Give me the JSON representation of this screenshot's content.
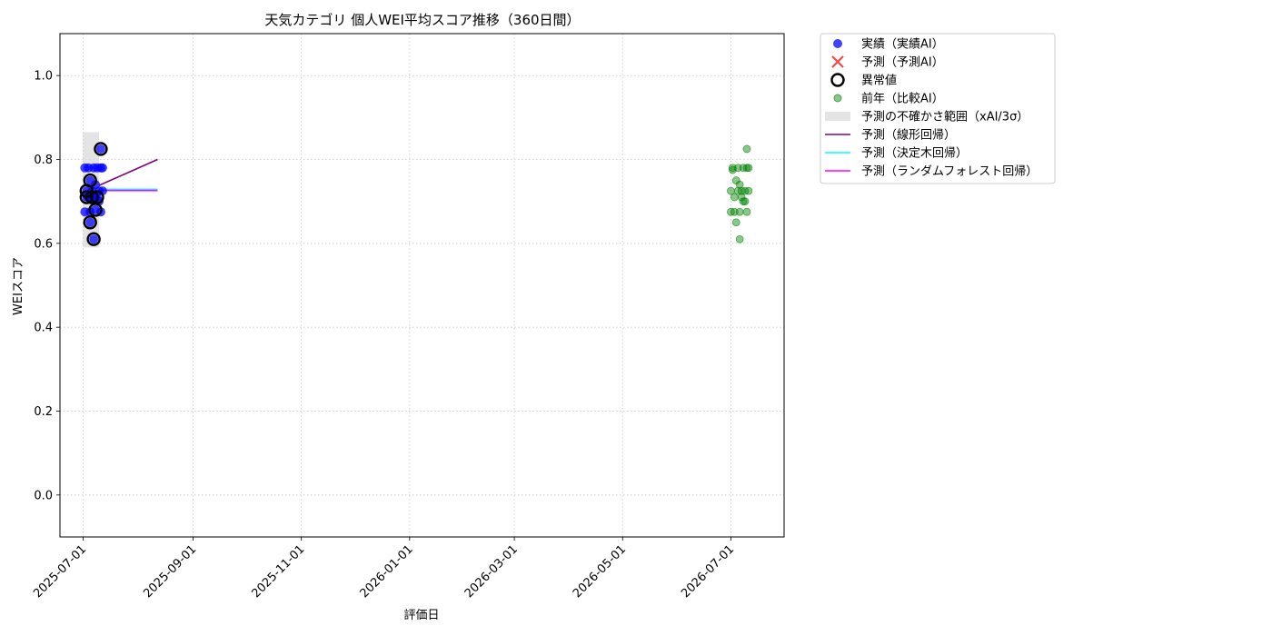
{
  "chart_data": {
    "type": "scatter",
    "title": "天気カテゴリ 個人WEI平均スコア推移（360日間）",
    "xlabel": "評価日",
    "ylabel": "WEIスコア",
    "ylim": [
      -0.1,
      1.1
    ],
    "xlim": [
      "2025-06-18",
      "2026-07-31"
    ],
    "x_ticks": [
      "2025-07-01",
      "2025-09-01",
      "2025-11-01",
      "2026-01-01",
      "2026-03-01",
      "2026-05-01",
      "2026-07-01"
    ],
    "y_ticks": [
      0.0,
      0.2,
      0.4,
      0.6,
      0.8,
      1.0
    ],
    "grid": true,
    "legend_position": "outside-top-right",
    "series": [
      {
        "name": "実績（実績AI）",
        "kind": "scatter",
        "color": "#0000ff",
        "points": [
          {
            "x": "2025-07-02",
            "y": 0.78
          },
          {
            "x": "2025-07-02",
            "y": 0.675
          },
          {
            "x": "2025-07-03",
            "y": 0.71
          },
          {
            "x": "2025-07-03",
            "y": 0.725
          },
          {
            "x": "2025-07-04",
            "y": 0.78
          },
          {
            "x": "2025-07-04",
            "y": 0.71
          },
          {
            "x": "2025-07-05",
            "y": 0.65
          },
          {
            "x": "2025-07-05",
            "y": 0.675
          },
          {
            "x": "2025-07-05",
            "y": 0.75
          },
          {
            "x": "2025-07-06",
            "y": 0.725
          },
          {
            "x": "2025-07-06",
            "y": 0.71
          },
          {
            "x": "2025-07-07",
            "y": 0.78
          },
          {
            "x": "2025-07-07",
            "y": 0.61
          },
          {
            "x": "2025-07-08",
            "y": 0.71
          },
          {
            "x": "2025-07-08",
            "y": 0.68
          },
          {
            "x": "2025-07-08",
            "y": 0.74
          },
          {
            "x": "2025-07-09",
            "y": 0.78
          },
          {
            "x": "2025-07-09",
            "y": 0.71
          },
          {
            "x": "2025-07-10",
            "y": 0.7
          },
          {
            "x": "2025-07-10",
            "y": 0.725
          },
          {
            "x": "2025-07-11",
            "y": 0.78
          },
          {
            "x": "2025-07-11",
            "y": 0.675
          },
          {
            "x": "2025-07-11",
            "y": 0.825
          },
          {
            "x": "2025-07-12",
            "y": 0.78
          },
          {
            "x": "2025-07-12",
            "y": 0.725
          }
        ]
      },
      {
        "name": "予測（予測AI）",
        "kind": "scatter",
        "color": "#ff0000",
        "points": []
      },
      {
        "name": "異常値",
        "kind": "scatter",
        "color": "#000000",
        "points": [
          {
            "x": "2025-07-03",
            "y": 0.71
          },
          {
            "x": "2025-07-03",
            "y": 0.725
          },
          {
            "x": "2025-07-05",
            "y": 0.75
          },
          {
            "x": "2025-07-05",
            "y": 0.65
          },
          {
            "x": "2025-07-06",
            "y": 0.71
          },
          {
            "x": "2025-07-07",
            "y": 0.61
          },
          {
            "x": "2025-07-08",
            "y": 0.68
          },
          {
            "x": "2025-07-09",
            "y": 0.71
          },
          {
            "x": "2025-07-11",
            "y": 0.825
          }
        ]
      },
      {
        "name": "前年（比較AI）",
        "kind": "scatter",
        "color": "#008000",
        "points": [
          {
            "x": "2026-07-01",
            "y": 0.675
          },
          {
            "x": "2026-07-01",
            "y": 0.725
          },
          {
            "x": "2026-07-02",
            "y": 0.78
          },
          {
            "x": "2026-07-02",
            "y": 0.775
          },
          {
            "x": "2026-07-03",
            "y": 0.71
          },
          {
            "x": "2026-07-03",
            "y": 0.675
          },
          {
            "x": "2026-07-04",
            "y": 0.65
          },
          {
            "x": "2026-07-04",
            "y": 0.75
          },
          {
            "x": "2026-07-05",
            "y": 0.725
          },
          {
            "x": "2026-07-05",
            "y": 0.78
          },
          {
            "x": "2026-07-06",
            "y": 0.61
          },
          {
            "x": "2026-07-06",
            "y": 0.74
          },
          {
            "x": "2026-07-06",
            "y": 0.675
          },
          {
            "x": "2026-07-07",
            "y": 0.71
          },
          {
            "x": "2026-07-07",
            "y": 0.725
          },
          {
            "x": "2026-07-08",
            "y": 0.7
          },
          {
            "x": "2026-07-08",
            "y": 0.78
          },
          {
            "x": "2026-07-09",
            "y": 0.725
          },
          {
            "x": "2026-07-09",
            "y": 0.7
          },
          {
            "x": "2026-07-10",
            "y": 0.825
          },
          {
            "x": "2026-07-10",
            "y": 0.78
          },
          {
            "x": "2026-07-10",
            "y": 0.675
          },
          {
            "x": "2026-07-11",
            "y": 0.78
          },
          {
            "x": "2026-07-11",
            "y": 0.725
          }
        ]
      },
      {
        "name": "予測の不確かさ範囲（xAI/3σ）",
        "kind": "band",
        "color": "#d9d9d9",
        "x_range": [
          "2025-07-01",
          "2025-07-10"
        ],
        "y_range": [
          0.59,
          0.865
        ]
      },
      {
        "name": "予測（線形回帰）",
        "kind": "line",
        "color": "#800080",
        "points": [
          {
            "x": "2025-07-10",
            "y": 0.738
          },
          {
            "x": "2025-08-12",
            "y": 0.8
          }
        ]
      },
      {
        "name": "予測（決定木回帰）",
        "kind": "line",
        "color": "#00ffff",
        "points": [
          {
            "x": "2025-07-10",
            "y": 0.729
          },
          {
            "x": "2025-08-12",
            "y": 0.729
          }
        ]
      },
      {
        "name": "予測（ランダムフォレスト回帰）",
        "kind": "line",
        "color": "#ff00ff",
        "points": [
          {
            "x": "2025-07-10",
            "y": 0.726
          },
          {
            "x": "2025-08-12",
            "y": 0.726
          }
        ]
      }
    ]
  }
}
